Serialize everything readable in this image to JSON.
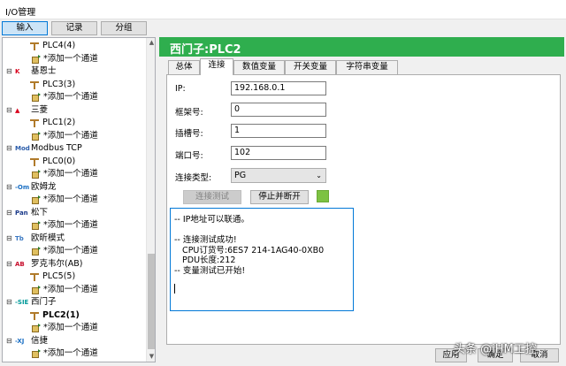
{
  "window": {
    "title": "I/O管理"
  },
  "top_buttons": [
    {
      "label": "输入",
      "active": true
    },
    {
      "label": "记录",
      "active": false
    },
    {
      "label": "分组",
      "active": false
    }
  ],
  "tree": {
    "rows": [
      {
        "type": "device",
        "label": "PLC4(4)"
      },
      {
        "type": "add",
        "label": "*添加一个通道"
      },
      {
        "type": "brand",
        "label": "基恩士",
        "icon": "keyence-icon"
      },
      {
        "type": "device",
        "label": "PLC3(3)"
      },
      {
        "type": "add",
        "label": "*添加一个通道"
      },
      {
        "type": "brand",
        "label": "三菱",
        "icon": "mitsubishi-icon"
      },
      {
        "type": "device",
        "label": "PLC1(2)"
      },
      {
        "type": "add",
        "label": "*添加一个通道"
      },
      {
        "type": "brand",
        "label": "Modbus TCP",
        "icon": "modbus-icon"
      },
      {
        "type": "device",
        "label": "PLC0(0)"
      },
      {
        "type": "add",
        "label": "*添加一个通道"
      },
      {
        "type": "brand",
        "label": "欧姆龙",
        "icon": "omron-icon"
      },
      {
        "type": "add",
        "label": "*添加一个通道"
      },
      {
        "type": "brand",
        "label": "松下",
        "icon": "panasonic-icon"
      },
      {
        "type": "add",
        "label": "*添加一个通道"
      },
      {
        "type": "brand",
        "label": "欧昕模式",
        "icon": "fins-icon"
      },
      {
        "type": "add",
        "label": "*添加一个通道"
      },
      {
        "type": "brand",
        "label": "罗克韦尔(AB)",
        "icon": "rockwell-icon"
      },
      {
        "type": "device",
        "label": "PLC5(5)"
      },
      {
        "type": "add",
        "label": "*添加一个通道"
      },
      {
        "type": "brand",
        "label": "西门子",
        "icon": "siemens-icon"
      },
      {
        "type": "device",
        "label": "PLC2(1)",
        "selected": true
      },
      {
        "type": "add",
        "label": "*添加一个通道"
      },
      {
        "type": "brand",
        "label": "信捷",
        "icon": "xinje-icon"
      },
      {
        "type": "add",
        "label": "*添加一个通道"
      }
    ]
  },
  "header": {
    "title": "西门子:PLC2"
  },
  "tabs": [
    {
      "label": "总体",
      "active": false
    },
    {
      "label": "连接",
      "active": true
    },
    {
      "label": "数值变量",
      "active": false
    },
    {
      "label": "开关变量",
      "active": false
    },
    {
      "label": "字符串变量",
      "active": false
    }
  ],
  "form": {
    "ip": {
      "label": "IP:",
      "value": "192.168.0.1"
    },
    "rack": {
      "label": "框架号:",
      "value": "0"
    },
    "slot": {
      "label": "插槽号:",
      "value": "1"
    },
    "port": {
      "label": "端口号:",
      "value": "102"
    },
    "conn_type": {
      "label": "连接类型:",
      "value": "PG"
    }
  },
  "buttons": {
    "test": "连接测试",
    "stop": "停止并断开"
  },
  "log_lines": [
    "-- IP地址可以联通。",
    "",
    "-- 连接测试成功!",
    "   CPU订货号:6ES7 214-1AG40-0XB0",
    "   PDU长度:212",
    "-- 变量测试已开始!"
  ],
  "bottom_buttons": [
    "应用",
    "确定",
    "取消"
  ],
  "watermark": "头条 @iHM工控",
  "colors": {
    "header": "#2fae4e",
    "status": "#7dc242"
  }
}
